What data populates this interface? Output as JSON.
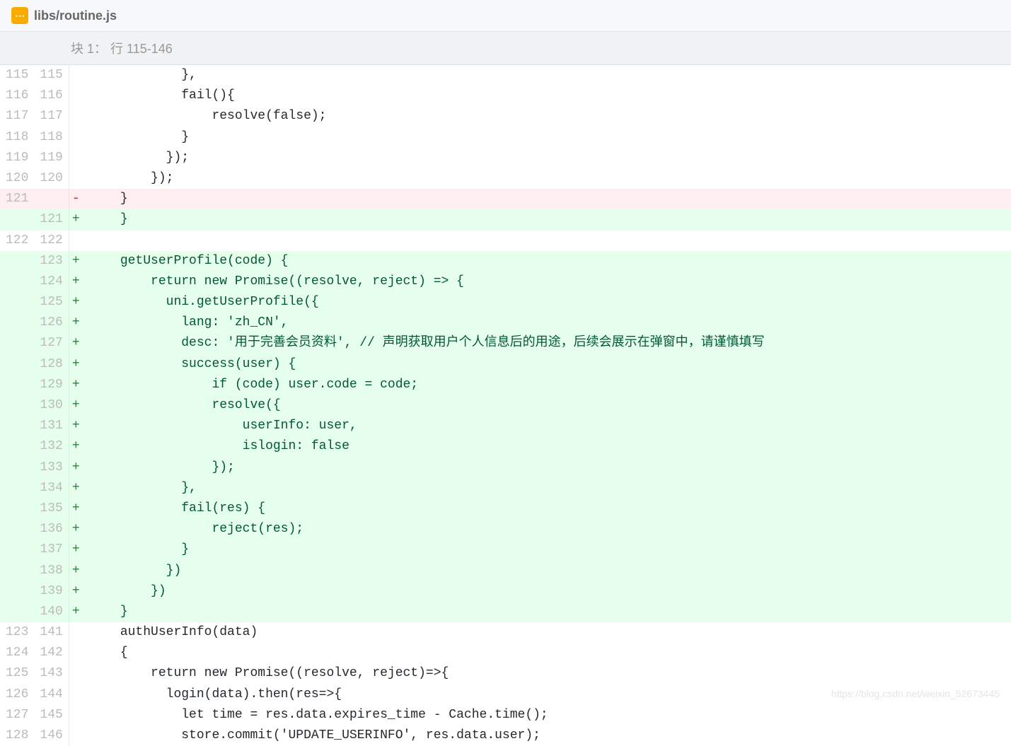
{
  "file": {
    "path": "libs/routine.js"
  },
  "hunk": {
    "label": "块 1：  行 115-146"
  },
  "lines": [
    {
      "old": "115",
      "new": "115",
      "type": "context",
      "code": "            },"
    },
    {
      "old": "116",
      "new": "116",
      "type": "context",
      "code": "            fail(){"
    },
    {
      "old": "117",
      "new": "117",
      "type": "context",
      "code": "                resolve(false);"
    },
    {
      "old": "118",
      "new": "118",
      "type": "context",
      "code": "            }"
    },
    {
      "old": "119",
      "new": "119",
      "type": "context",
      "code": "          });"
    },
    {
      "old": "120",
      "new": "120",
      "type": "context",
      "code": "        });"
    },
    {
      "old": "121",
      "new": "",
      "type": "deleted",
      "code": "    }"
    },
    {
      "old": "",
      "new": "121",
      "type": "added",
      "code": "    }"
    },
    {
      "old": "122",
      "new": "122",
      "type": "context",
      "code": ""
    },
    {
      "old": "",
      "new": "123",
      "type": "added",
      "code": "    getUserProfile(code) {"
    },
    {
      "old": "",
      "new": "124",
      "type": "added",
      "code": "        return new Promise((resolve, reject) => {"
    },
    {
      "old": "",
      "new": "125",
      "type": "added",
      "code": "          uni.getUserProfile({"
    },
    {
      "old": "",
      "new": "126",
      "type": "added",
      "code": "            lang: 'zh_CN',"
    },
    {
      "old": "",
      "new": "127",
      "type": "added",
      "code": "            desc: '用于完善会员资料', // 声明获取用户个人信息后的用途，后续会展示在弹窗中，请谨慎填写"
    },
    {
      "old": "",
      "new": "128",
      "type": "added",
      "code": "            success(user) {"
    },
    {
      "old": "",
      "new": "129",
      "type": "added",
      "code": "                if (code) user.code = code;"
    },
    {
      "old": "",
      "new": "130",
      "type": "added",
      "code": "                resolve({"
    },
    {
      "old": "",
      "new": "131",
      "type": "added",
      "code": "                    userInfo: user,"
    },
    {
      "old": "",
      "new": "132",
      "type": "added",
      "code": "                    islogin: false"
    },
    {
      "old": "",
      "new": "133",
      "type": "added",
      "code": "                });"
    },
    {
      "old": "",
      "new": "134",
      "type": "added",
      "code": "            },"
    },
    {
      "old": "",
      "new": "135",
      "type": "added",
      "code": "            fail(res) {"
    },
    {
      "old": "",
      "new": "136",
      "type": "added",
      "code": "                reject(res);"
    },
    {
      "old": "",
      "new": "137",
      "type": "added",
      "code": "            }"
    },
    {
      "old": "",
      "new": "138",
      "type": "added",
      "code": "          })"
    },
    {
      "old": "",
      "new": "139",
      "type": "added",
      "code": "        })"
    },
    {
      "old": "",
      "new": "140",
      "type": "added",
      "code": "    }"
    },
    {
      "old": "123",
      "new": "141",
      "type": "context",
      "code": "    authUserInfo(data)"
    },
    {
      "old": "124",
      "new": "142",
      "type": "context",
      "code": "    {"
    },
    {
      "old": "125",
      "new": "143",
      "type": "context",
      "code": "        return new Promise((resolve, reject)=>{"
    },
    {
      "old": "126",
      "new": "144",
      "type": "context",
      "code": "          login(data).then(res=>{"
    },
    {
      "old": "127",
      "new": "145",
      "type": "context",
      "code": "            let time = res.data.expires_time - Cache.time();"
    },
    {
      "old": "128",
      "new": "146",
      "type": "context",
      "code": "            store.commit('UPDATE_USERINFO', res.data.user);"
    }
  ],
  "watermark": "https://blog.csdn.net/weixin_52673445"
}
